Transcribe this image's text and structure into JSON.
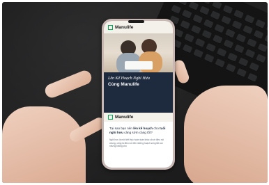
{
  "phone_screen": {
    "brand": "Manulife",
    "hero_title": "Lên Kế Hoạch Nghỉ Hưu",
    "hero_subtitle": "Cùng Manulife",
    "card_brand": "Manulife",
    "question_prefix": "Tại sao bạn nên ",
    "question_bold_1": "lên kế hoạch",
    "question_mid": " cho ",
    "question_bold_2": "tuổi nghỉ hưu",
    "question_suffix": " càng sớm càng tốt?",
    "body_text": "Nghỉ hưu là một kết thúc hoàn toàn khác cả về điều nói chung, cũng là điều nói đến những hoạch sống tắt con nhưng không cho"
  },
  "colors": {
    "brand_green": "#00a758",
    "navy": "#1e2a3d",
    "cream": "#f4f1ea"
  }
}
